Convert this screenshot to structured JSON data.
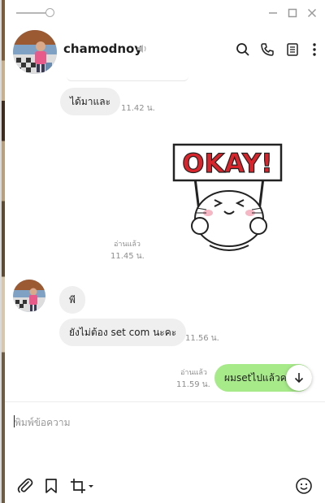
{
  "titlebar": {
    "opacity_level": 1.0,
    "minimize_icon": "minimize-icon",
    "maximize_icon": "maximize-icon",
    "close_icon": "close-icon"
  },
  "header": {
    "name": "chamodnoy",
    "mute_icon": "speaker-muted-icon",
    "icons": [
      "search-icon",
      "phone-icon",
      "notes-icon",
      "more-icon"
    ]
  },
  "messages": [
    {
      "id": "m1",
      "direction": "in",
      "text": "ได้มาและ",
      "time": "11.42 น."
    },
    {
      "id": "m2",
      "direction": "out",
      "type": "sticker",
      "sticker_text": "OKAY!",
      "read": "อ่านแล้ว",
      "time": "11.45 น."
    },
    {
      "id": "m3",
      "direction": "in",
      "text": "พี",
      "time": ""
    },
    {
      "id": "m4",
      "direction": "in",
      "text": "ยังไม่ต้อง set com นะคะ",
      "time": "11.56 น."
    },
    {
      "id": "m5",
      "direction": "out",
      "text": "ผมsetไปแล้วค",
      "read": "อ่านแล้ว",
      "time": "11.59 น."
    }
  ],
  "input": {
    "placeholder": "พิมพ์ข้อความ"
  },
  "toolbar": {
    "icons": [
      "paperclip-icon",
      "bookmark-icon",
      "crop-icon",
      "emoji-icon"
    ]
  },
  "colors": {
    "incoming_bubble": "#efefef",
    "outgoing_bubble": "#a7ea8a",
    "sticker_red": "#d8242a"
  }
}
